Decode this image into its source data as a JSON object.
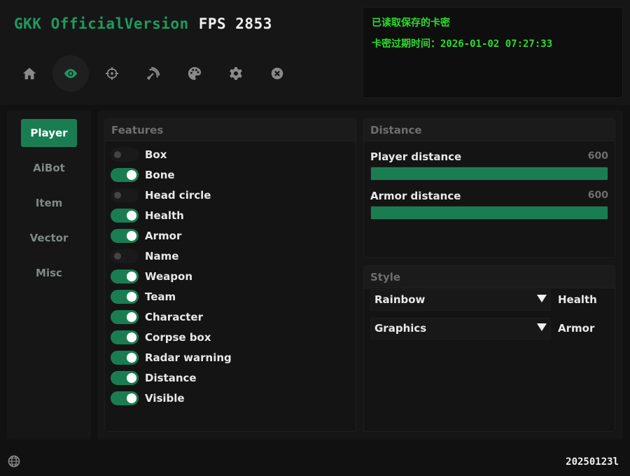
{
  "header": {
    "brand": "GKK OfficialVersion",
    "fps": "FPS 2853",
    "toolbar": [
      {
        "icon": "home-icon",
        "active": false
      },
      {
        "icon": "eye-icon",
        "active": true
      },
      {
        "icon": "crosshair-icon",
        "active": false
      },
      {
        "icon": "radar-icon",
        "active": false
      },
      {
        "icon": "palette-icon",
        "active": false
      },
      {
        "icon": "gear-icon",
        "active": false
      },
      {
        "icon": "close-icon",
        "active": false
      }
    ]
  },
  "info": {
    "line1": "已读取保存的卡密",
    "line2": "卡密过期时间：2026-01-02 07:27:33"
  },
  "sidebar": {
    "items": [
      {
        "label": "Player",
        "active": true
      },
      {
        "label": "AiBot",
        "active": false
      },
      {
        "label": "Item",
        "active": false
      },
      {
        "label": "Vector",
        "active": false
      },
      {
        "label": "Misc",
        "active": false
      }
    ]
  },
  "features": {
    "title": "Features",
    "items": [
      {
        "label": "Box",
        "on": false
      },
      {
        "label": "Bone",
        "on": true
      },
      {
        "label": "Head circle",
        "on": false
      },
      {
        "label": "Health",
        "on": true
      },
      {
        "label": "Armor",
        "on": true
      },
      {
        "label": "Name",
        "on": false
      },
      {
        "label": "Weapon",
        "on": true
      },
      {
        "label": "Team",
        "on": true
      },
      {
        "label": "Character",
        "on": true
      },
      {
        "label": "Corpse box",
        "on": true
      },
      {
        "label": "Radar warning",
        "on": true
      },
      {
        "label": "Distance",
        "on": true
      },
      {
        "label": "Visible",
        "on": true
      }
    ]
  },
  "distance": {
    "title": "Distance",
    "sliders": [
      {
        "label": "Player distance",
        "value": "600",
        "fill": 1.0
      },
      {
        "label": "Armor distance",
        "value": "600",
        "fill": 1.0
      }
    ]
  },
  "style": {
    "title": "Style",
    "rows": [
      {
        "selected": "Rainbow",
        "label": "Health"
      },
      {
        "selected": "Graphics",
        "label": "Armor"
      }
    ]
  },
  "footer": {
    "build": "20250123l"
  },
  "colors": {
    "accent": "#1a7d52",
    "brand": "#1e9a5e",
    "info_text": "#2bdc2b"
  }
}
